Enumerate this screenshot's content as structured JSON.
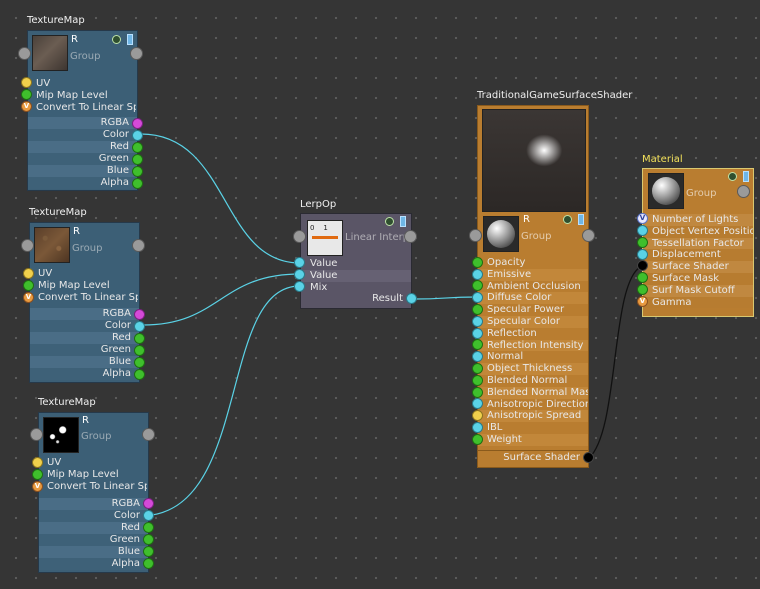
{
  "texture_nodes": [
    {
      "title": "TextureMap",
      "r": "R",
      "group": "Group",
      "inputs": [
        {
          "label": "UV",
          "color": "#f0d04c"
        },
        {
          "label": "Mip Map Level",
          "color": "#3fbf2c"
        },
        {
          "label": "Convert To Linear Sp",
          "color": "#e89a40",
          "badge": "V"
        }
      ],
      "outputs": [
        "RGBA",
        "Color",
        "Red",
        "Green",
        "Blue",
        "Alpha"
      ]
    },
    {
      "title": "TextureMap",
      "r": "R",
      "group": "Group",
      "inputs": [
        {
          "label": "UV",
          "color": "#f0d04c"
        },
        {
          "label": "Mip Map Level",
          "color": "#3fbf2c"
        },
        {
          "label": "Convert To Linear Sp",
          "color": "#e89a40",
          "badge": "V"
        }
      ],
      "outputs": [
        "RGBA",
        "Color",
        "Red",
        "Green",
        "Blue",
        "Alpha"
      ]
    },
    {
      "title": "TextureMap",
      "r": "R",
      "group": "Group",
      "inputs": [
        {
          "label": "UV",
          "color": "#f0d04c"
        },
        {
          "label": "Mip Map Level",
          "color": "#3fbf2c"
        },
        {
          "label": "Convert To Linear Sp",
          "color": "#e89a40",
          "badge": "V"
        }
      ],
      "outputs": [
        "RGBA",
        "Color",
        "Red",
        "Green",
        "Blue",
        "Alpha"
      ]
    }
  ],
  "lerp": {
    "title": "LerpOp",
    "op_label": "Linear Interp",
    "icon_text": "0    1",
    "inputs": [
      "Value",
      "Value",
      "Mix"
    ],
    "output": "Result"
  },
  "shader": {
    "title": "TraditionalGameSurfaceShader",
    "r": "R",
    "group": "Group",
    "inputs": [
      {
        "label": "Opacity",
        "color": "#3fbf2c"
      },
      {
        "label": "Emissive",
        "color": "#5ad2e6"
      },
      {
        "label": "Ambient Occlusion",
        "color": "#3fbf2c"
      },
      {
        "label": "Diffuse Color",
        "color": "#5ad2e6"
      },
      {
        "label": "Specular Power",
        "color": "#3fbf2c"
      },
      {
        "label": "Specular Color",
        "color": "#5ad2e6"
      },
      {
        "label": "Reflection",
        "color": "#5ad2e6"
      },
      {
        "label": "Reflection Intensity",
        "color": "#3fbf2c"
      },
      {
        "label": "Normal",
        "color": "#5ad2e6"
      },
      {
        "label": "Object Thickness",
        "color": "#3fbf2c"
      },
      {
        "label": "Blended Normal",
        "color": "#3fbf2c"
      },
      {
        "label": "Blended Normal Mask",
        "color": "#3fbf2c"
      },
      {
        "label": "Anisotropic Direction",
        "color": "#5ad2e6"
      },
      {
        "label": "Anisotropic Spread",
        "color": "#f0d04c"
      },
      {
        "label": "IBL",
        "color": "#5ad2e6"
      },
      {
        "label": "Weight",
        "color": "#3fbf2c"
      }
    ],
    "output": "Surface Shader"
  },
  "material": {
    "title": "Material",
    "group": "Group",
    "inputs": [
      {
        "label": "Number of Lights",
        "color": "#e8e8ff",
        "badge": "V"
      },
      {
        "label": "Object Vertex Positio",
        "color": "#5ad2e6"
      },
      {
        "label": "Tessellation Factor",
        "color": "#3fbf2c"
      },
      {
        "label": "Displacement",
        "color": "#5ad2e6"
      },
      {
        "label": "Surface Shader",
        "color": "#000000"
      },
      {
        "label": "Surface Mask",
        "color": "#3fbf2c"
      },
      {
        "label": "Surf Mask Cutoff",
        "color": "#3fbf2c"
      },
      {
        "label": "Gamma",
        "color": "#e89a40",
        "badge": "V"
      }
    ]
  },
  "colors": {
    "background": "#353535",
    "texture_node": "#3c5f76",
    "lerp_node": "#5a5566",
    "shader_node": "#b97d30",
    "material_title": "#f2e05a",
    "wire": "#5ad2e6"
  }
}
